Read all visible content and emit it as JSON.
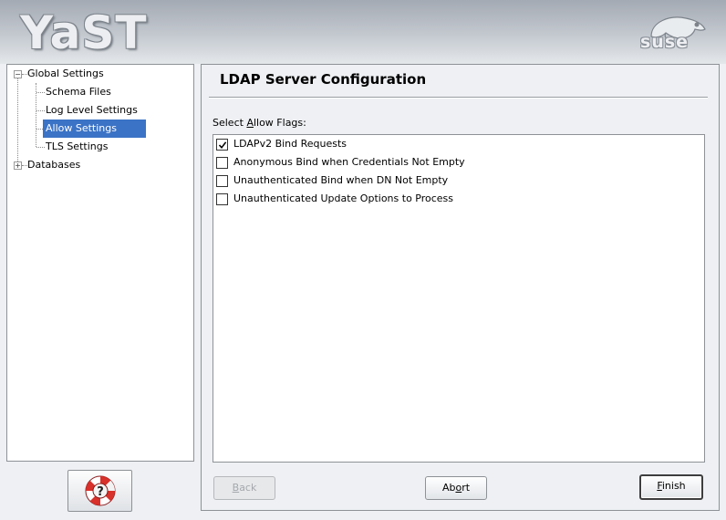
{
  "header": {
    "app_logo": "YaST",
    "vendor_logo": "suse",
    "colors": {
      "banner": "#b7bcc3",
      "selection": "#3b73c6"
    }
  },
  "tree": {
    "items": [
      {
        "label": "Global Settings",
        "level": 0,
        "expander": "minus"
      },
      {
        "label": "Schema Files",
        "level": 1
      },
      {
        "label": "Log Level Settings",
        "level": 1
      },
      {
        "label": "Allow Settings",
        "level": 1,
        "selected": true
      },
      {
        "label": "TLS Settings",
        "level": 1
      },
      {
        "label": "Databases",
        "level": 0,
        "expander": "plus"
      }
    ]
  },
  "help": {
    "icon": "help-lifebuoy-icon"
  },
  "main": {
    "title": "LDAP Server Configuration",
    "list_label_pre": "Select ",
    "list_label_mnemonic": "A",
    "list_label_post": "llow Flags:",
    "flags": [
      {
        "label": "LDAPv2 Bind Requests",
        "checked": true
      },
      {
        "label": "Anonymous Bind when Credentials Not Empty",
        "checked": false
      },
      {
        "label": "Unauthenticated Bind when DN Not Empty",
        "checked": false
      },
      {
        "label": "Unauthenticated Update Options to Process",
        "checked": false
      }
    ]
  },
  "buttons": {
    "back": {
      "mnemonic": "B",
      "rest": "ack",
      "enabled": false
    },
    "abort": {
      "pre": "Ab",
      "mnemonic": "o",
      "rest": "rt"
    },
    "finish": {
      "mnemonic": "F",
      "rest": "inish"
    }
  }
}
